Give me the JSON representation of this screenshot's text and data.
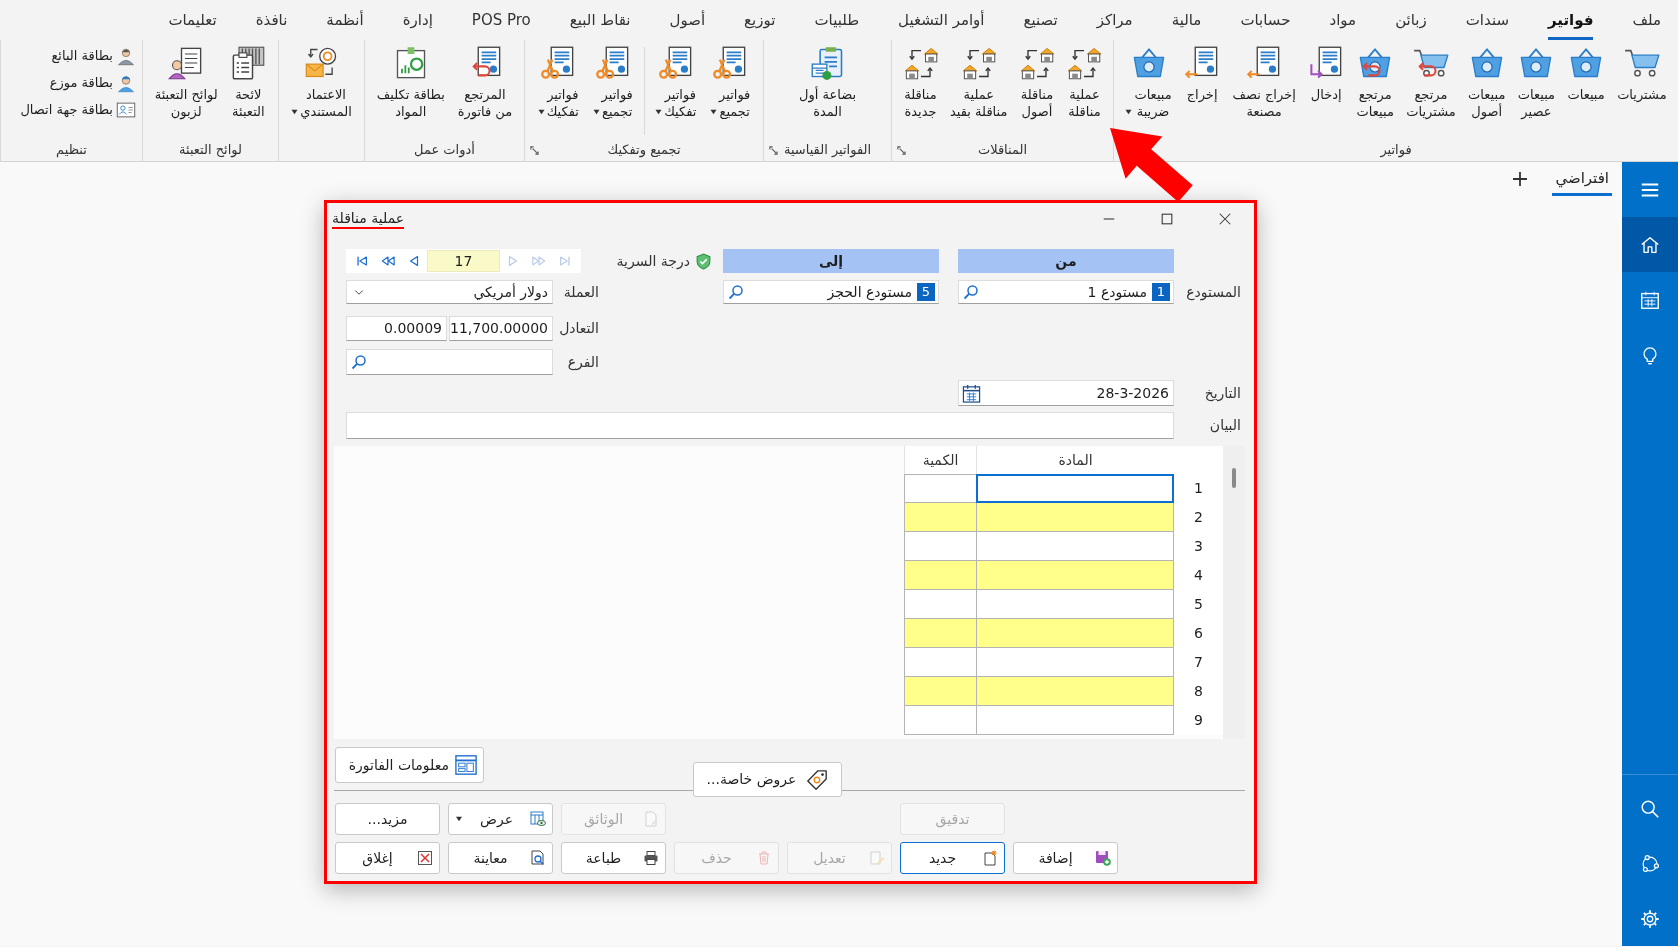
{
  "menu_bar": [
    {
      "label": "ملف",
      "selected": false
    },
    {
      "label": "فواتير",
      "selected": true
    },
    {
      "label": "سندات",
      "selected": false
    },
    {
      "label": "زبائن",
      "selected": false
    },
    {
      "label": "مواد",
      "selected": false
    },
    {
      "label": "حسابات",
      "selected": false
    },
    {
      "label": "مالية",
      "selected": false
    },
    {
      "label": "مراكز",
      "selected": false
    },
    {
      "label": "تصنيع",
      "selected": false
    },
    {
      "label": "أوامر التشغيل",
      "selected": false
    },
    {
      "label": "طلبيات",
      "selected": false
    },
    {
      "label": "توزيع",
      "selected": false
    },
    {
      "label": "أصول",
      "selected": false
    },
    {
      "label": "نقاط البيع",
      "selected": false
    },
    {
      "label": "POS Pro",
      "selected": false
    },
    {
      "label": "إدارة",
      "selected": false
    },
    {
      "label": "أنظمة",
      "selected": false
    },
    {
      "label": "نافذة",
      "selected": false
    },
    {
      "label": "تعليمات",
      "selected": false
    }
  ],
  "ribbon": [
    {
      "label": "فواتير",
      "kind": "large",
      "launcher": false,
      "buttons": [
        {
          "label": "مشتريات",
          "kind": "cart",
          "menu": false,
          "divider": false
        },
        {
          "label": "مبيعات",
          "kind": "basket",
          "menu": false,
          "divider": false
        },
        {
          "label": "مبيعات\nعصير",
          "kind": "basket",
          "menu": false,
          "divider": false
        },
        {
          "label": "مبيعات\nأصول",
          "kind": "basket",
          "menu": false,
          "divider": false
        },
        {
          "label": "مرتجع\nمشتريات",
          "kind": "cart_return",
          "menu": false,
          "divider": false
        },
        {
          "label": "مرتجع\nمبيعات",
          "kind": "basket_return",
          "menu": false,
          "divider": false
        },
        {
          "label": "إدخال",
          "kind": "doc_in",
          "menu": false,
          "divider": false
        },
        {
          "label": "إخراج نصف\nمصنعة",
          "kind": "doc_out",
          "menu": false,
          "divider": false
        },
        {
          "label": "إخراج",
          "kind": "doc_out",
          "menu": false,
          "divider": false
        },
        {
          "label": "مبيعات\nضريبة",
          "kind": "basket",
          "menu": true,
          "divider": false
        }
      ]
    },
    {
      "label": "المناقلات",
      "kind": "large",
      "launcher": true,
      "buttons": [
        {
          "label": "عملية\nمناقلة",
          "kind": "transfer",
          "menu": false,
          "divider": false
        },
        {
          "label": "مناقلة\nأصول",
          "kind": "transfer",
          "menu": false,
          "divider": false
        },
        {
          "label": "عملية\nمناقلة بقيد",
          "kind": "transfer",
          "menu": false,
          "divider": false
        },
        {
          "label": "مناقلة\nجديدة",
          "kind": "transfer",
          "menu": false,
          "divider": false
        }
      ]
    },
    {
      "label": "الفواتير القياسية",
      "kind": "large",
      "launcher": true,
      "buttons": [
        {
          "label": "بضاعة أول\nالمدة",
          "kind": "opening",
          "menu": false,
          "divider": false
        }
      ]
    },
    {
      "label": "تجميع وتفكيك",
      "kind": "large",
      "launcher": true,
      "buttons": [
        {
          "label": "فواتير\nتجميع",
          "kind": "assembly",
          "menu": true,
          "divider": false
        },
        {
          "label": "فواتير\nتفكيك",
          "kind": "assembly",
          "menu": true,
          "divider": false
        },
        {
          "label": "فواتير\nتجميع",
          "kind": "assembly",
          "menu": true,
          "divider": true
        },
        {
          "label": "فواتير\nتفكيك",
          "kind": "assembly",
          "menu": true,
          "divider": false
        }
      ]
    },
    {
      "label": "أدوات عمل",
      "kind": "large",
      "launcher": false,
      "buttons": [
        {
          "label": "المرتجع\nمن فاتورة",
          "kind": "doc_return",
          "menu": false,
          "divider": false
        },
        {
          "label": "بطاقة تكليف\nالمواد",
          "kind": "cost_card",
          "menu": false,
          "divider": false
        }
      ]
    },
    {
      "kind": "large",
      "launcher": false,
      "buttons": [
        {
          "label": "الاعتماد\nالمستندي",
          "kind": "credit",
          "menu": true,
          "divider": false
        }
      ]
    },
    {
      "label": "لوائح التعبئة",
      "kind": "large",
      "launcher": false,
      "buttons": [
        {
          "label": "لائحة\nالتعبئة",
          "kind": "packing",
          "menu": false,
          "divider": false
        },
        {
          "label": "لوائح التعبئة\nلزبون",
          "kind": "customer_list",
          "menu": false,
          "divider": false
        }
      ]
    },
    {
      "label": "تنظيم",
      "kind": "small",
      "launcher": false,
      "buttons": [
        {
          "label": "بطاقة البائع",
          "kind": "seller",
          "menu": false,
          "divider": false
        },
        {
          "label": "بطاقة موزع",
          "kind": "distributor",
          "menu": false,
          "divider": false
        },
        {
          "label": "بطاقة جهة اتصال",
          "kind": "contact",
          "menu": false,
          "divider": false
        }
      ]
    }
  ],
  "workspace": {
    "tabs": [
      {
        "label": "افتراضي",
        "selected": true
      }
    ]
  },
  "sidebar": {
    "top": [
      {
        "kind": "menu",
        "selected": false
      },
      {
        "kind": "home",
        "selected": true
      },
      {
        "kind": "calendar",
        "selected": false
      },
      {
        "kind": "bulb",
        "selected": false
      }
    ],
    "bottom": [
      {
        "kind": "search",
        "selected": false
      },
      {
        "kind": "network",
        "selected": false
      },
      {
        "kind": "settings",
        "selected": false
      }
    ]
  },
  "dialog": {
    "title": "عملية مناقلة",
    "navigator": {
      "back": [
        {
          "kind": "first",
          "disabled": false
        },
        {
          "kind": "rewind",
          "disabled": false
        },
        {
          "kind": "previous",
          "disabled": false
        }
      ],
      "number": "17",
      "forward": [
        {
          "kind": "next",
          "disabled": true
        },
        {
          "kind": "forward",
          "disabled": true
        },
        {
          "kind": "last",
          "disabled": true
        }
      ]
    },
    "secrecy_label": "درجة السرية",
    "warehouse_label": "المستودع",
    "columns": [
      {
        "header": "من",
        "warehouse": {
          "code": "1",
          "name": "مستودع 1"
        }
      },
      {
        "header": "إلى",
        "warehouse": {
          "code": "5",
          "name": "مستودع الحجز"
        }
      }
    ],
    "currency": {
      "label": "العملة",
      "value": "دولار أمريكي"
    },
    "rate": {
      "label": "التعادل",
      "value": "11,700.00000",
      "inverse": "0.00009"
    },
    "branch": {
      "label": "الفرع"
    },
    "date": {
      "label": "التاريخ",
      "value": "28-3-2026"
    },
    "statement": {
      "label": "البيان"
    },
    "table": {
      "columns": [
        "المادة",
        "الكمية"
      ],
      "rows": [
        {
          "number": "1",
          "focused": true
        },
        {
          "number": "2",
          "focused": false
        },
        {
          "number": "3",
          "focused": false
        },
        {
          "number": "4",
          "focused": false
        },
        {
          "number": "5",
          "focused": false
        },
        {
          "number": "6",
          "focused": false
        },
        {
          "number": "7",
          "focused": false
        },
        {
          "number": "8",
          "focused": false
        },
        {
          "number": "9",
          "focused": false
        }
      ]
    },
    "info_button": "معلومات الفاتورة",
    "offers_button": "عروض خاصة...",
    "buttons_top": [
      {
        "label": "تدقيق",
        "kind": "plain",
        "disabled": true,
        "focused": false,
        "menu": false
      },
      {
        "label": "الوثائق",
        "kind": "documents",
        "disabled": true,
        "focused": false,
        "menu": false
      },
      {
        "label": "عرض",
        "kind": "view",
        "disabled": false,
        "focused": false,
        "menu": true
      },
      {
        "label": "مزيد...",
        "kind": "plain",
        "disabled": false,
        "focused": false,
        "menu": false
      }
    ],
    "buttons_bottom": [
      {
        "label": "إضافة",
        "kind": "save_add",
        "disabled": false,
        "focused": false,
        "menu": false
      },
      {
        "label": "جديد",
        "kind": "new",
        "disabled": false,
        "focused": true,
        "menu": false
      },
      {
        "label": "تعديل",
        "kind": "edit",
        "disabled": true,
        "focused": false,
        "menu": false
      },
      {
        "label": "حذف",
        "kind": "delete",
        "disabled": true,
        "focused": false,
        "menu": false
      },
      {
        "label": "طباعة",
        "kind": "print",
        "disabled": false,
        "focused": false,
        "menu": false
      },
      {
        "label": "معاينة",
        "kind": "preview",
        "disabled": false,
        "focused": false,
        "menu": false
      },
      {
        "label": "إغلاق",
        "kind": "close",
        "disabled": false,
        "focused": false,
        "menu": false
      }
    ]
  }
}
